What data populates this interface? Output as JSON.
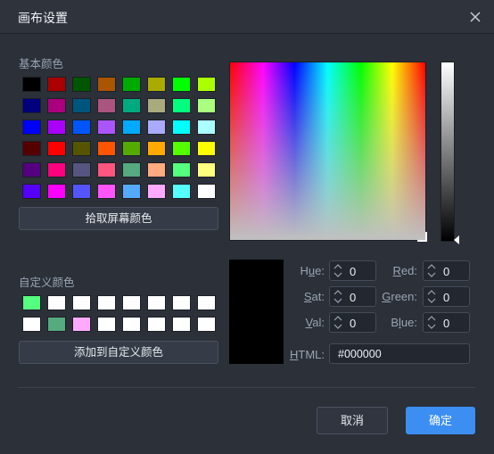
{
  "dialog": {
    "title": "画布设置"
  },
  "basic_colors": {
    "label": "基本颜色",
    "rows": [
      [
        "#000000",
        "#aa0000",
        "#005500",
        "#aa5500",
        "#00aa00",
        "#aaaa00",
        "#00ff00",
        "#aaff00"
      ],
      [
        "#00007f",
        "#aa007f",
        "#00557f",
        "#aa557f",
        "#00aa7f",
        "#aaaa7f",
        "#00ff7f",
        "#aaff7f"
      ],
      [
        "#0000ff",
        "#aa00ff",
        "#0055ff",
        "#aa55ff",
        "#00aaff",
        "#aaaaff",
        "#00ffff",
        "#aaffff"
      ],
      [
        "#550000",
        "#ff0000",
        "#555500",
        "#ff5500",
        "#55aa00",
        "#ffaa00",
        "#55ff00",
        "#ffff00"
      ],
      [
        "#55007f",
        "#ff007f",
        "#55557f",
        "#ff557f",
        "#55aa7f",
        "#ffaa7f",
        "#55ff7f",
        "#ffff7f"
      ],
      [
        "#5500ff",
        "#ff00ff",
        "#5555ff",
        "#ff55ff",
        "#55aaff",
        "#ffaaff",
        "#55ffff",
        "#ffffff"
      ]
    ],
    "pick_screen_button": "拾取屏幕颜色"
  },
  "custom_colors": {
    "label": "自定义颜色",
    "rows": [
      [
        "#55ff7f",
        "#ffffff",
        "#ffffff",
        "#ffffff",
        "#ffffff",
        "#ffffff",
        "#ffffff",
        "#ffffff"
      ],
      [
        "#ffffff",
        "#55aa7f",
        "#ffaaff",
        "#ffffff",
        "#ffffff",
        "#ffffff",
        "#ffffff",
        "#ffffff"
      ]
    ],
    "add_button": "添加到自定义颜色"
  },
  "fields": {
    "hue_label": "Hue:",
    "hue_value": "0",
    "sat_label": "Sat:",
    "sat_value": "0",
    "val_label": "Val:",
    "val_value": "0",
    "red_label": "Red:",
    "red_value": "0",
    "green_label": "Green:",
    "green_value": "0",
    "blue_label": "Blue:",
    "blue_value": "0",
    "html_label": "HTML:",
    "html_value": "#000000"
  },
  "current_color": "#000000",
  "buttons": {
    "cancel": "取消",
    "ok": "确定"
  },
  "colors": {
    "accent": "#3c8ef2",
    "background": "#2b3039"
  }
}
